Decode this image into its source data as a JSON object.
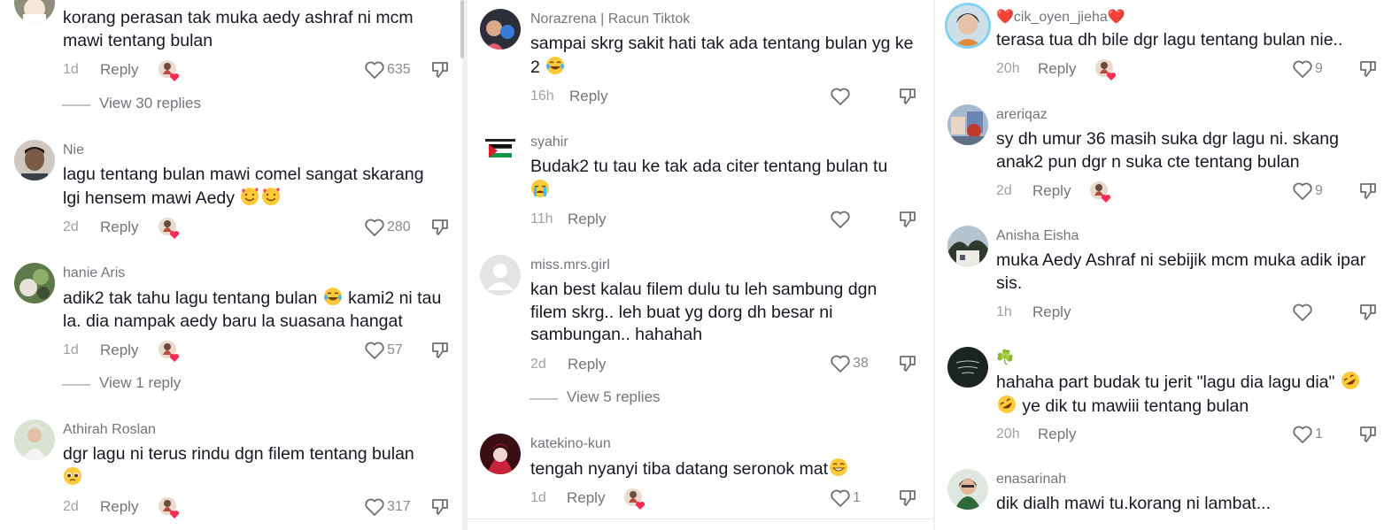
{
  "actions": {
    "reply": "Reply"
  },
  "colors": {
    "text": "#161823",
    "secondary": "#73757c",
    "muted": "#a0a1a6",
    "accent_heart": "#fe2c55"
  },
  "columns": [
    {
      "comments": [
        {
          "user": "",
          "text": "korang perasan tak muka aedy ashraf ni mcm mawi tentang bulan",
          "time": "1d",
          "likes": "635",
          "creator_liked": true,
          "view_replies": "View 30 replies"
        },
        {
          "user": "Nie",
          "text": "lagu tentang bulan mawi comel sangat skarang lgi hensem mawi Aedy",
          "emoji": [
            "smiling-hearts-emoji",
            "smiling-hearts-emoji"
          ],
          "time": "2d",
          "likes": "280",
          "creator_liked": true
        },
        {
          "user": "hanie Aris",
          "text_a": "adik2 tak tahu lagu tentang bulan",
          "emoji": [
            "tears-of-joy-emoji"
          ],
          "text_b": "kami2 ni tau la. dia nampak aedy baru la suasana hangat",
          "time": "1d",
          "likes": "57",
          "creator_liked": true,
          "view_replies": "View 1 reply"
        },
        {
          "user": "Athirah Roslan",
          "text": "dgr lagu ni terus rindu dgn filem tentang bulan",
          "emoji": [
            "pleading-face-emoji"
          ],
          "time": "2d",
          "likes": "317",
          "creator_liked": true
        }
      ]
    },
    {
      "comments": [
        {
          "user": "Norazrena | Racun Tiktok",
          "text": "sampai skrg sakit hati tak ada tentang bulan yg ke 2",
          "emoji": [
            "tears-of-joy-emoji"
          ],
          "time": "16h",
          "likes": "",
          "creator_liked": false
        },
        {
          "user": "syahir",
          "text": "Budak2 tu tau ke tak ada citer tentang bulan tu",
          "emoji": [
            "crying-face-emoji"
          ],
          "time": "11h",
          "likes": "",
          "creator_liked": false
        },
        {
          "user": "miss.mrs.girl",
          "text": "kan best kalau filem dulu tu leh sambung dgn filem skrg.. leh buat yg dorg dh besar ni sambungan.. hahahah",
          "time": "2d",
          "likes": "38",
          "creator_liked": false,
          "view_replies": "View 5 replies"
        },
        {
          "user": "katekino-kun",
          "text": "tengah nyanyi tiba datang seronok mat",
          "emoji": [
            "grinning-face-emoji"
          ],
          "time": "1d",
          "likes": "1",
          "creator_liked": true
        }
      ]
    },
    {
      "comments": [
        {
          "user": "cik_oyen_jieha",
          "user_prefix": "❤️",
          "user_suffix": "❤️",
          "text": "terasa tua dh bile dgr lagu tentang bulan nie..",
          "time": "20h",
          "likes": "9",
          "creator_liked": true
        },
        {
          "user": "areriqaz",
          "text": "sy dh umur 36 masih suka dgr lagu ni. skang anak2 pun dgr n suka cte tentang bulan",
          "time": "2d",
          "likes": "9",
          "creator_liked": true
        },
        {
          "user": "Anisha Eisha",
          "text": "muka Aedy Ashraf ni sebijik mcm muka adik ipar sis.",
          "time": "1h",
          "likes": "",
          "creator_liked": false
        },
        {
          "user": "☘️",
          "text_a": "hahaha part budak tu jerit \"lagu dia lagu dia\"",
          "emoji": [
            "rofl-emoji",
            "rofl-emoji"
          ],
          "text_b": "ye dik tu mawiii tentang bulan",
          "time": "20h",
          "likes": "1",
          "creator_liked": false
        },
        {
          "user": "enasarinah",
          "text": "dik dialh mawi tu.korang ni lambat...",
          "time": "",
          "likes": "",
          "creator_liked": false
        }
      ]
    }
  ]
}
